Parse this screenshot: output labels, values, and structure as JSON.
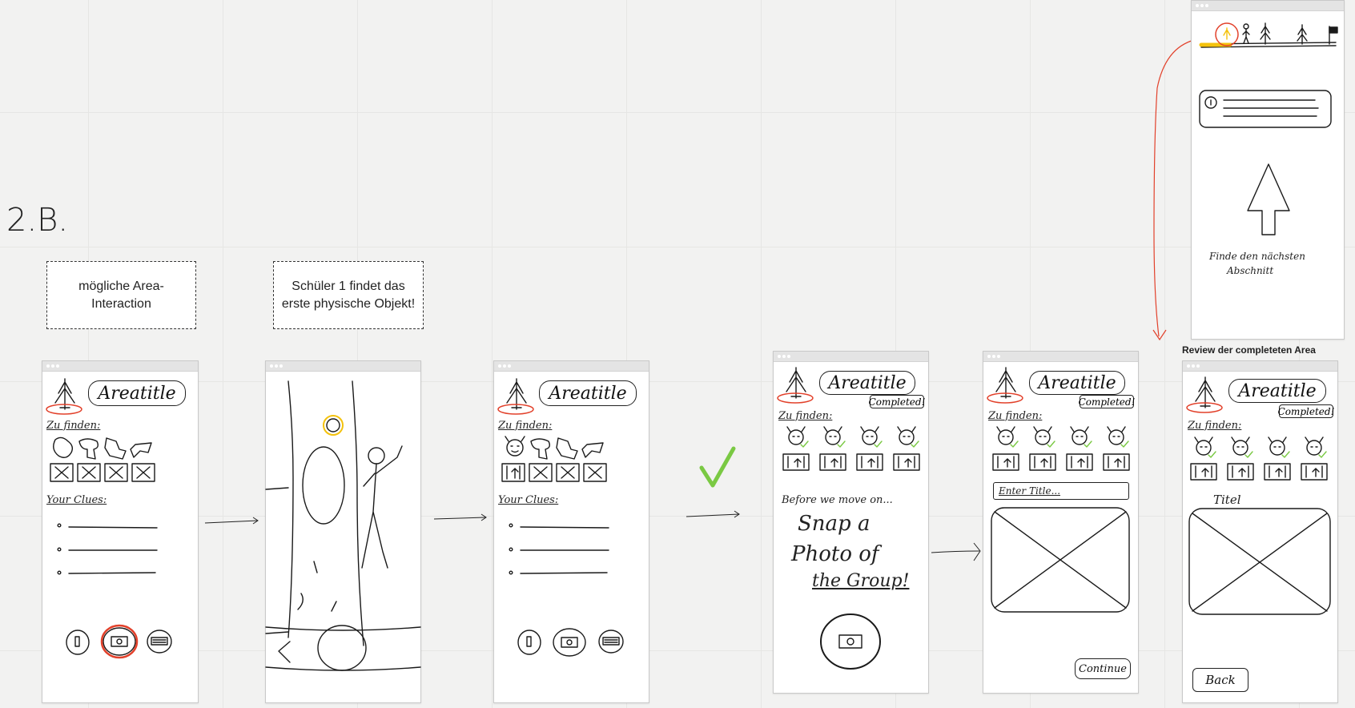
{
  "section_label": "2.B.",
  "notes": {
    "area_interaction": "mögliche Area-Interaction",
    "student_finds": "Schüler 1 findet das erste physische Objekt!"
  },
  "review_caption": "Review der completeten Area",
  "screen": {
    "area_title": "Areatitle",
    "zu_finden": "Zu finden:",
    "your_clues": "Your Clues:",
    "completed": "Completed!",
    "before_we_move_on": "Before we move on...",
    "snap_line1": "Snap a",
    "snap_line2": "Photo of",
    "snap_line3": "the Group!",
    "enter_title": "Enter Title...",
    "continue": "Continue",
    "titel": "Titel",
    "back": "Back",
    "finde_line1": "Finde den nächsten",
    "finde_line2": "Abschnitt"
  },
  "colors": {
    "accent_red": "#e2412b",
    "check_green": "#7ac943",
    "progress_yellow": "#f4c20d"
  },
  "icons": [
    "tree-logo-icon",
    "camera-icon",
    "flashlight-icon",
    "map-icon",
    "monster-icon",
    "check-icon",
    "info-icon",
    "arrow-up-icon",
    "finish-flag-icon"
  ]
}
